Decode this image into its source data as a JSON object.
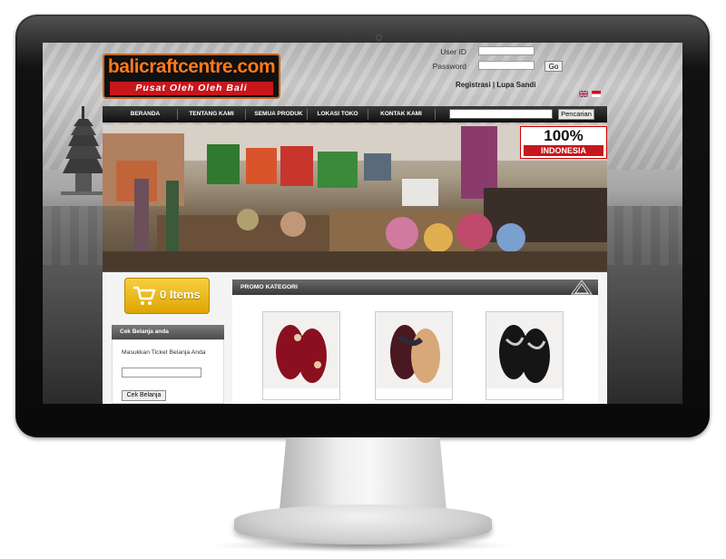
{
  "site": {
    "logo_text": "balicraftcentre.com",
    "logo_tagline": "Pusat Oleh Oleh Bali"
  },
  "login": {
    "userid_label": "User ID",
    "password_label": "Password",
    "go_label": "Go",
    "links": "Registrasi | Lupa Sandi"
  },
  "nav": {
    "items": [
      "BERANDA",
      "TENTANG KAMI",
      "SEMUA PRODUK",
      "LOKASI TOKO",
      "KONTAK KAMI"
    ],
    "search_button": "Pencarian"
  },
  "banner": {
    "badge_number": "100%",
    "badge_text": "INDONESIA"
  },
  "cart": {
    "label": "0 Items"
  },
  "cek_belanja": {
    "title": "Cek Belanja anda",
    "instruction": "Masukkan Ticket Belanja Anda",
    "button": "Cek Belanja"
  },
  "promo": {
    "title": "PROMO KATEGORI"
  },
  "colors": {
    "accent_orange": "#ff7a1a",
    "brand_red": "#c8161d",
    "cart_yellow": "#f1c232"
  }
}
